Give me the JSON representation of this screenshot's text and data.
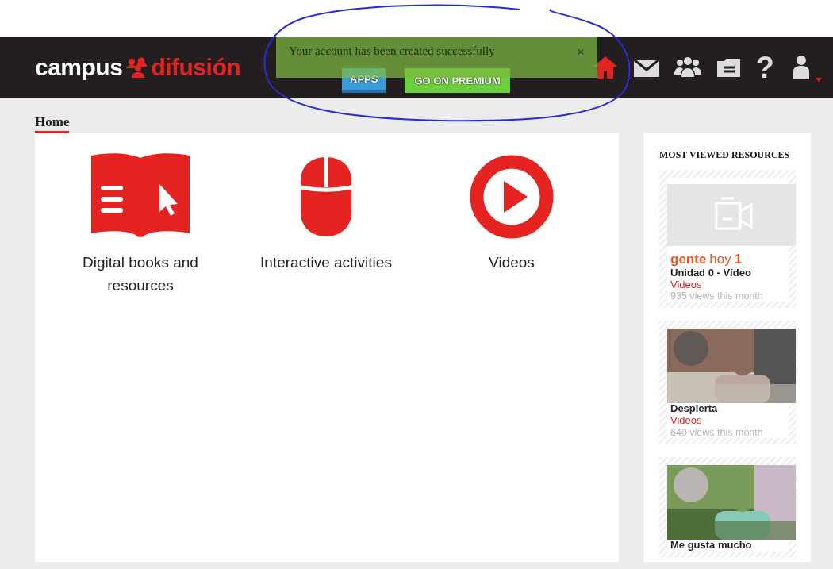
{
  "header": {
    "logo": {
      "first": "campus",
      "second": "difusión"
    },
    "buttons": [
      {
        "label": "APPS",
        "kind": "apps"
      },
      {
        "label": "GO ON PREMIUM",
        "kind": "premium"
      }
    ],
    "icons": [
      {
        "kind": "home",
        "active": true
      },
      {
        "kind": "mail",
        "active": false
      },
      {
        "kind": "group",
        "active": false
      },
      {
        "kind": "folder",
        "active": false
      },
      {
        "kind": "help",
        "glyph": "?",
        "active": false
      },
      {
        "kind": "user",
        "active": false
      }
    ]
  },
  "toast": {
    "message": "Your account has been created successfully",
    "close": "×"
  },
  "tabs": [
    {
      "label": "Home",
      "selected": true
    }
  ],
  "tiles": [
    {
      "kind": "book",
      "label": "Digital books and resources"
    },
    {
      "kind": "mouse",
      "label": "Interactive activities"
    },
    {
      "kind": "video",
      "label": "Videos"
    }
  ],
  "sidebar": {
    "title": "MOST VIEWED RESOURCES",
    "items": [
      {
        "kind": "placeholder",
        "brand": "gente",
        "brand_light": "hoy",
        "brand_number": "1",
        "title": "Unidad 0 - Vídeo",
        "category": "Videos",
        "views": "935 views this month"
      },
      {
        "kind": "picture",
        "title": "Despierta",
        "category": "Videos",
        "views": "640 views this month"
      },
      {
        "kind": "picture",
        "title": "Me gusta mucho"
      }
    ]
  }
}
